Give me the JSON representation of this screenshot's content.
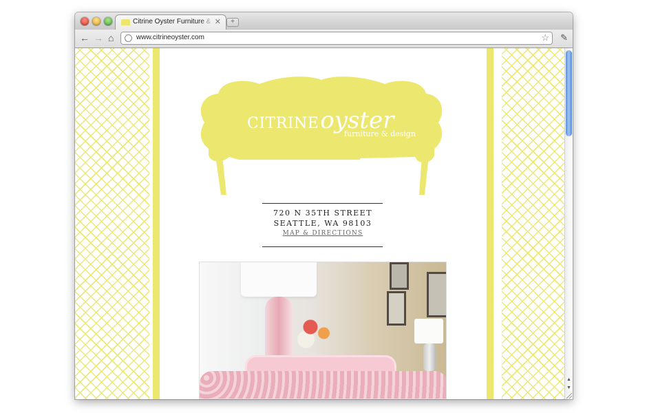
{
  "browser": {
    "tab_title": "Citrine Oyster Furniture & De",
    "tab_close": "✕",
    "new_tab": "+",
    "url": "www.citrineoyster.com",
    "icons": [
      "back-arrow-icon",
      "forward-arrow-icon",
      "home-icon",
      "globe-icon",
      "bookmark-star-icon",
      "wrench-icon",
      "close-icon"
    ]
  },
  "site": {
    "logo": {
      "citrine": "CITRINE",
      "oyster": "oyster",
      "tagline": "furniture & design"
    },
    "address_line1": "720 N 35TH STREET",
    "address_line2": "SEATTLE, WA 98103",
    "map_link": "MAP & DIRECTIONS"
  },
  "colors": {
    "accent": "#ece86f",
    "pattern": "#ece878"
  }
}
